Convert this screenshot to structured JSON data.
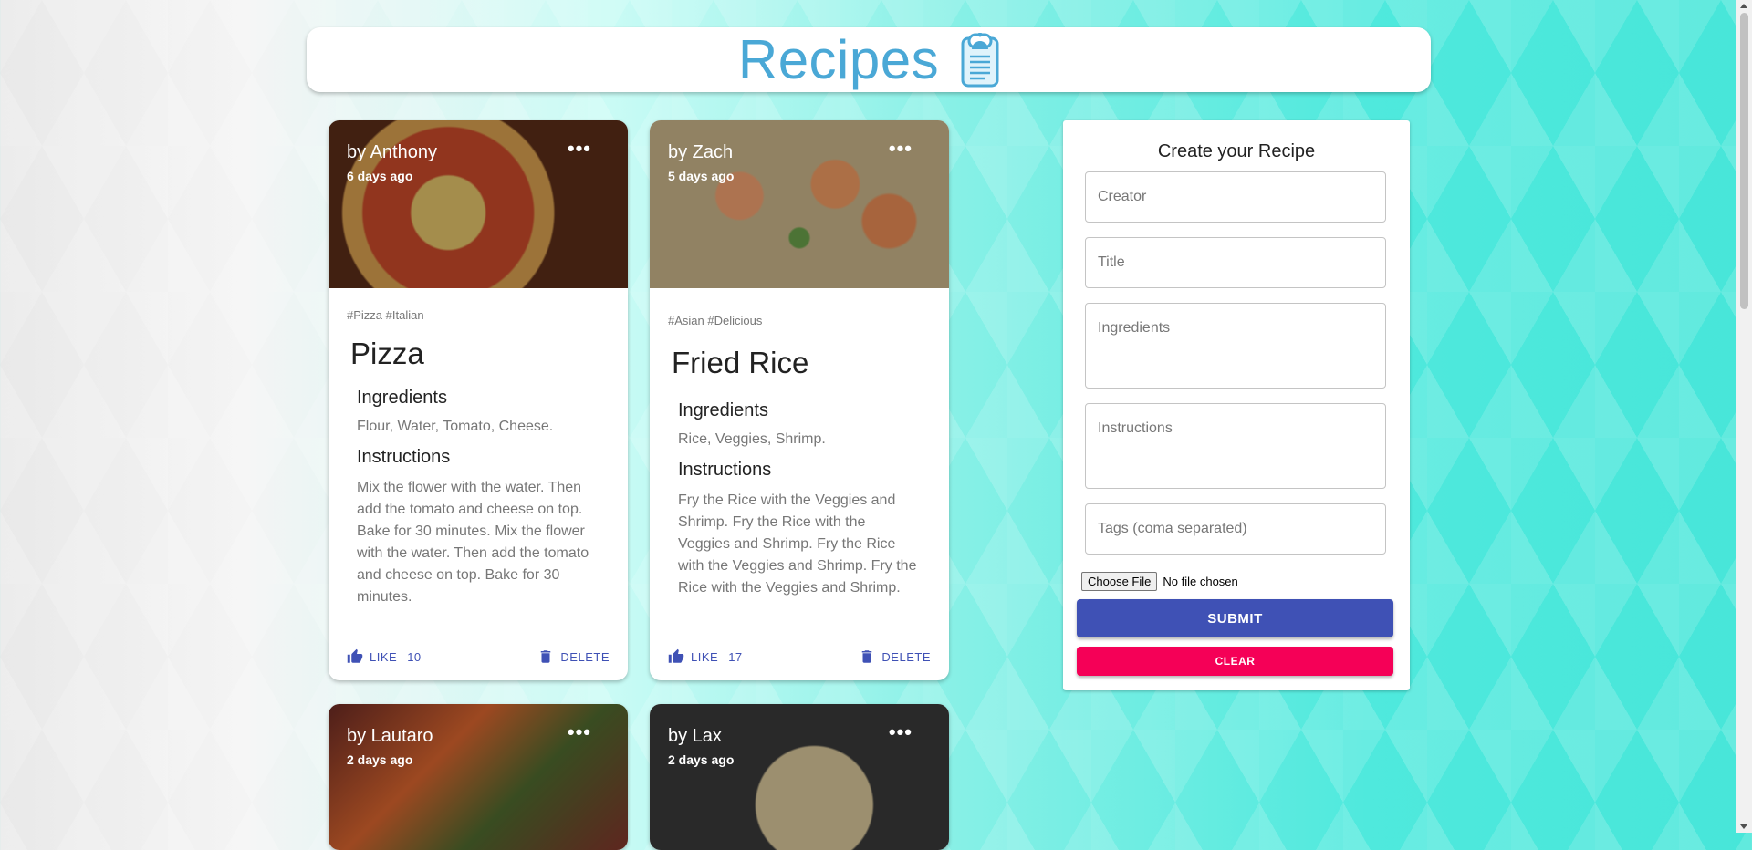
{
  "header": {
    "title": "Recipes"
  },
  "posts": [
    {
      "creator": "by Anthony",
      "time": "6 days ago",
      "tags": "#Pizza #Italian",
      "title": "Pizza",
      "ingredients_heading": "Ingredients",
      "ingredients": "Flour, Water, Tomato, Cheese.",
      "instructions_heading": "Instructions",
      "instructions": "Mix the flower with the water. Then add the tomato and cheese on top. Bake for 30 minutes. Mix the flower with the water. Then add the tomato and cheese on top. Bake for 30 minutes.",
      "like_label": "LIKE",
      "like_count": "10",
      "delete_label": "DELETE",
      "more": "•••",
      "image_colors": [
        "#7a3f22",
        "#c94a2a",
        "#e4c46a"
      ]
    },
    {
      "creator": "by Zach",
      "time": "5 days ago",
      "tags": "#Asian #Delicious",
      "title": "Fried Rice",
      "ingredients_heading": "Ingredients",
      "ingredients": "Rice, Veggies, Shrimp.",
      "instructions_heading": "Instructions",
      "instructions": "Fry the Rice with the Veggies and Shrimp. Fry the Rice with the Veggies and Shrimp. Fry the Rice with the Veggies and Shrimp. Fry the Rice with the Veggies and Shrimp.",
      "like_label": "LIKE",
      "like_count": "17",
      "delete_label": "DELETE",
      "more": "•••",
      "image_colors": [
        "#8a6a3c",
        "#e0915a",
        "#6aa04a"
      ]
    },
    {
      "creator": "by Lautaro",
      "time": "2 days ago",
      "more": "•••",
      "image_colors": [
        "#6b2a24",
        "#d9652e",
        "#4f6a2e"
      ]
    },
    {
      "creator": "by Lax",
      "time": "2 days ago",
      "more": "•••",
      "image_colors": [
        "#3a3a3a",
        "#d9c79a",
        "#8f8f8f"
      ]
    }
  ],
  "form": {
    "heading": "Create your Recipe",
    "creator_placeholder": "Creator",
    "title_placeholder": "Title",
    "ingredients_placeholder": "Ingredients",
    "instructions_placeholder": "Instructions",
    "tags_placeholder": "Tags (coma separated)",
    "file_button": "Choose File",
    "file_status": "No file chosen",
    "submit_label": "SUBMIT",
    "clear_label": "CLEAR",
    "colors": {
      "primary": "#3f51b5",
      "secondary": "#f50057"
    }
  },
  "icons": {
    "like": "thumb-up-icon",
    "delete": "trash-icon",
    "more": "more-horiz-icon",
    "logo": "recipe-clipboard-icon"
  }
}
